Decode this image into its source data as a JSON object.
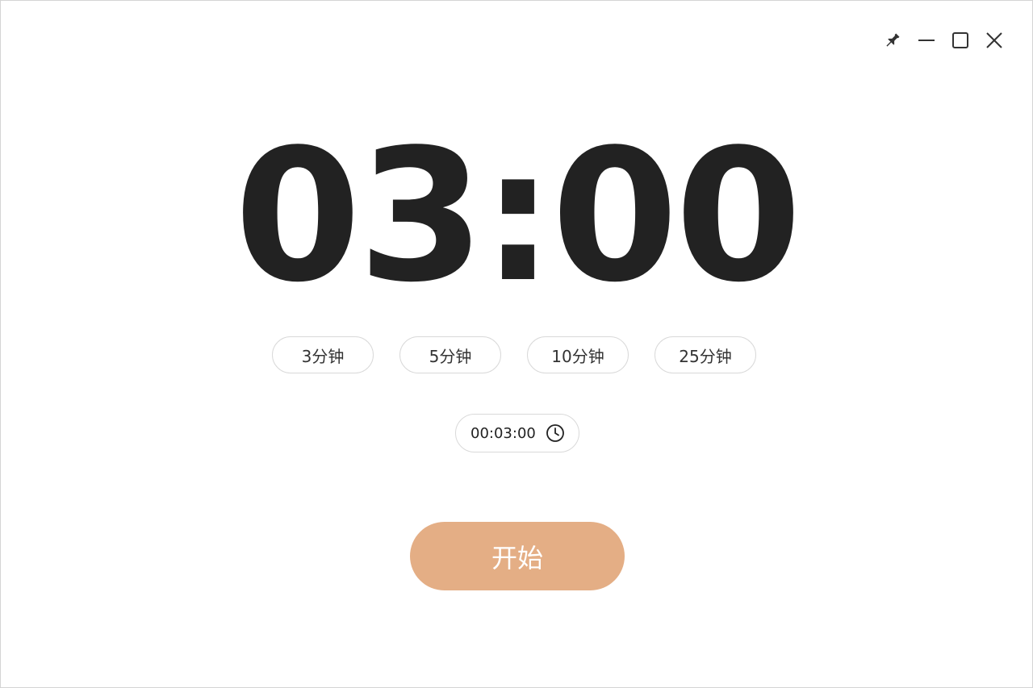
{
  "window": {
    "controls": {
      "pin_icon": "pin-icon",
      "minimize_icon": "minimize-icon",
      "maximize_icon": "maximize-icon",
      "close_icon": "close-icon"
    }
  },
  "timer": {
    "display": "03:00"
  },
  "presets": [
    {
      "label": "3分钟"
    },
    {
      "label": "5分钟"
    },
    {
      "label": "10分钟"
    },
    {
      "label": "25分钟"
    }
  ],
  "time_picker": {
    "value": "00:03:00",
    "icon": "clock-icon"
  },
  "start_button": {
    "label": "开始",
    "color": "#e4ae85"
  },
  "colors": {
    "text_primary": "#222222",
    "border": "#d9d9d9",
    "accent": "#e4ae85"
  }
}
